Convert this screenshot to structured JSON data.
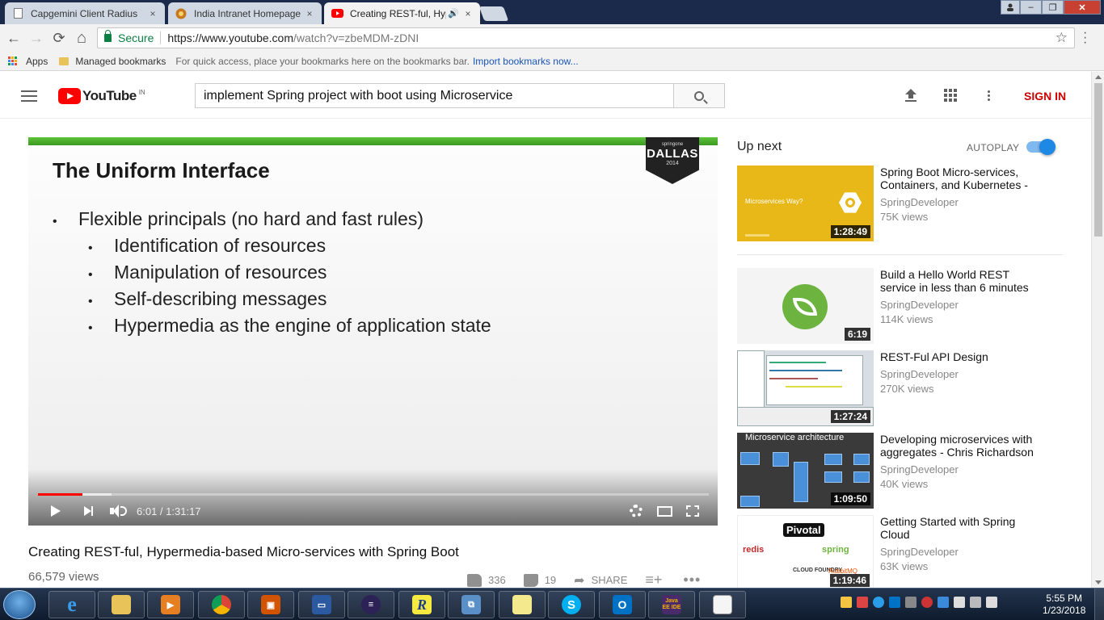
{
  "browser": {
    "tabs": [
      {
        "title": "Capgemini Client Radius",
        "close": "×"
      },
      {
        "title": "India Intranet Homepage",
        "close": "×"
      },
      {
        "title": "Creating REST-ful, Hyp",
        "close": "×"
      }
    ],
    "audio_icon": "🔊",
    "window_buttons": {
      "minimize": "–",
      "restore": "❐",
      "close": "✕"
    },
    "nav": {
      "back": "←",
      "forward": "→",
      "reload": "⟳",
      "home": "⌂"
    },
    "omnibox": {
      "secure_label": "Secure",
      "url_host": "https://www.youtube.com",
      "url_path": "/watch?v=zbeMDM-zDNI",
      "star": "☆"
    },
    "bookmarks_bar": {
      "apps_label": "Apps",
      "managed_label": "Managed bookmarks",
      "hint": "For quick access, place your bookmarks here on the bookmarks bar.",
      "import_link": "Import bookmarks now..."
    }
  },
  "youtube": {
    "logo_word": "YouTube",
    "country": "IN",
    "search_value": "implement Spring project with boot using Microservice",
    "signin_label": "SIGN IN"
  },
  "player": {
    "slide": {
      "title": "The Uniform Interface",
      "badge_top": "springone",
      "badge_city": "DALLAS",
      "badge_year": "2014",
      "main_bullet": "Flexible principals (no hard and fast rules)",
      "sub_bullets": [
        "Identification of resources",
        "Manipulation of resources",
        "Self-describing messages",
        "Hypermedia as the engine of application state"
      ],
      "bullet_glyph": "•"
    },
    "time_current": "6:01",
    "time_separator": " / ",
    "time_total": "1:31:17",
    "progress_played": 0.066,
    "progress_buffered": 0.11
  },
  "video": {
    "title": "Creating REST-ful, Hypermedia-based Micro-services with Spring Boot",
    "views": "66,579 views",
    "likes": "336",
    "dislikes": "19",
    "share_label": "SHARE",
    "add_icon": "≡+",
    "more_icon": "•••"
  },
  "sidebar": {
    "up_next": "Up next",
    "autoplay_label": "AUTOPLAY",
    "autoplay_on": true,
    "recommendations": [
      {
        "title": "Spring Boot Micro-services, Containers, and Kubernetes -",
        "channel": "SpringDeveloper",
        "views": "75K views",
        "duration": "1:28:49",
        "thumb_text": "Microservices Way?"
      },
      {
        "title": "Build a Hello World REST service in less than 6 minutes",
        "channel": "SpringDeveloper",
        "views": "114K views",
        "duration": "6:19"
      },
      {
        "title": "REST-Ful API Design",
        "channel": "SpringDeveloper",
        "views": "270K views",
        "duration": "1:27:24"
      },
      {
        "title": "Developing microservices with aggregates - Chris Richardson",
        "channel": "SpringDeveloper",
        "views": "40K views",
        "duration": "1:09:50",
        "thumb_text": "Microservice architecture"
      },
      {
        "title": "Getting Started with Spring Cloud",
        "channel": "SpringDeveloper",
        "views": "63K views",
        "duration": "1:19:46",
        "thumb_labels": [
          "Pivotal",
          "redis",
          "spring",
          "CLOUD FOUNDRY",
          "RabbitMQ"
        ]
      }
    ]
  },
  "taskbar": {
    "apps": [
      "internet-explorer",
      "file-explorer",
      "media-player",
      "chrome",
      "office-app",
      "remote-desktop",
      "eclipse",
      "r-app",
      "network-app",
      "sticky-notes",
      "skype",
      "outlook",
      "java-ee-ide",
      "notepad-app"
    ],
    "java_ide_label": "Java EE IDE",
    "r_label": "R",
    "clock_time": "5:55 PM",
    "clock_date": "1/23/2018"
  },
  "colors": {
    "youtube_red": "#ff0000",
    "signin_red": "#cc0000",
    "secure_green": "#0b8043",
    "autoplay_blue": "#1e88e5",
    "slide_green": "#4fb52e",
    "spring_green": "#6db33f"
  }
}
